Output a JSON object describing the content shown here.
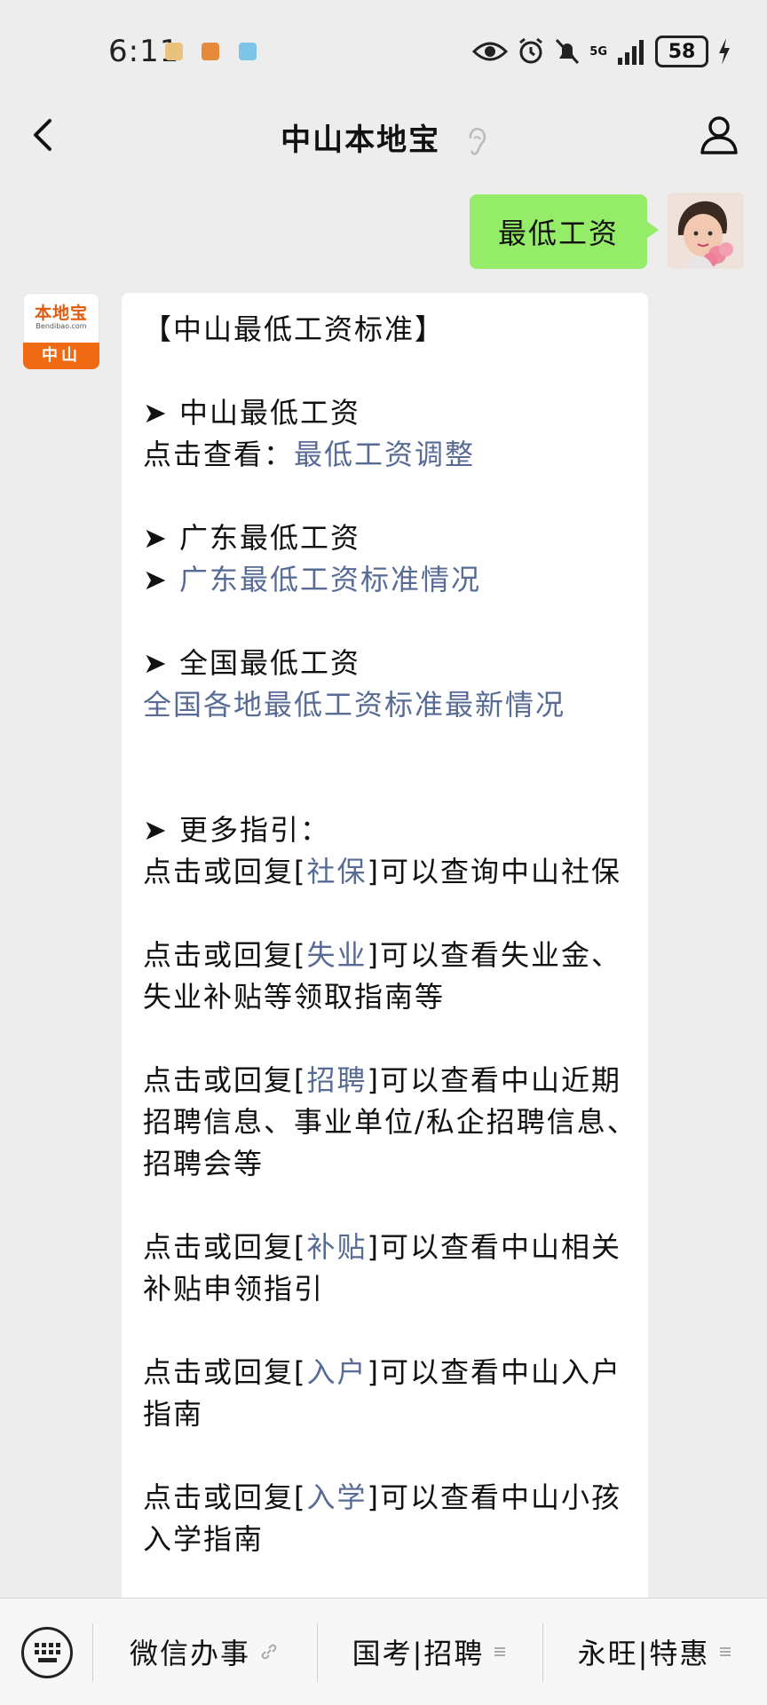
{
  "status_bar": {
    "time": "6:11",
    "network": "5G",
    "battery": "58"
  },
  "header": {
    "title": "中山本地宝"
  },
  "sent_message": {
    "text": "最低工资"
  },
  "bot": {
    "avatar_logo": "本地宝",
    "avatar_domain": "Bendibao.com",
    "avatar_city": "中山",
    "lines": {
      "title": "【中山最低工资标准】",
      "s1_head": "➤ 中山最低工资",
      "s1_prefix": "点击查看：",
      "s1_link": "最低工资调整",
      "s2_head": "➤ 广东最低工资",
      "s2_arrow": "➤ ",
      "s2_link": "广东最低工资标准情况",
      "s3_head": "➤ 全国最低工资",
      "s3_link": "全国各地最低工资标准最新情况",
      "more_head": "➤ 更多指引：",
      "r_prefix": "点击或回复[",
      "r_close": "]",
      "i1_kw": "社保",
      "i1_rest": "可以查询中山社保",
      "i2_kw": "失业",
      "i2_rest": "可以查看失业金、失业补贴等领取指南等",
      "i3_kw": "招聘",
      "i3_rest": "可以查看中山近期招聘信息、事业单位/私企招聘信息、招聘会等",
      "i4_kw": "补贴",
      "i4_rest": "可以查看中山相关补贴申领指引",
      "i5_kw": "入户",
      "i5_rest": "可以查看中山入户指南",
      "i6_kw": "入学",
      "i6_rest": "可以查看中山小孩入学指南"
    }
  },
  "menu": {
    "item1": "微信办事",
    "item2": "国考|招聘",
    "item3": "永旺|特惠"
  },
  "colors": {
    "link": "#576b95",
    "sent_bubble": "#95ec69",
    "brand_orange": "#ef6a12"
  },
  "icons": [
    "back-icon",
    "ear-icon",
    "profile-icon",
    "keyboard-icon",
    "link-icon",
    "menu-lines-icon"
  ]
}
